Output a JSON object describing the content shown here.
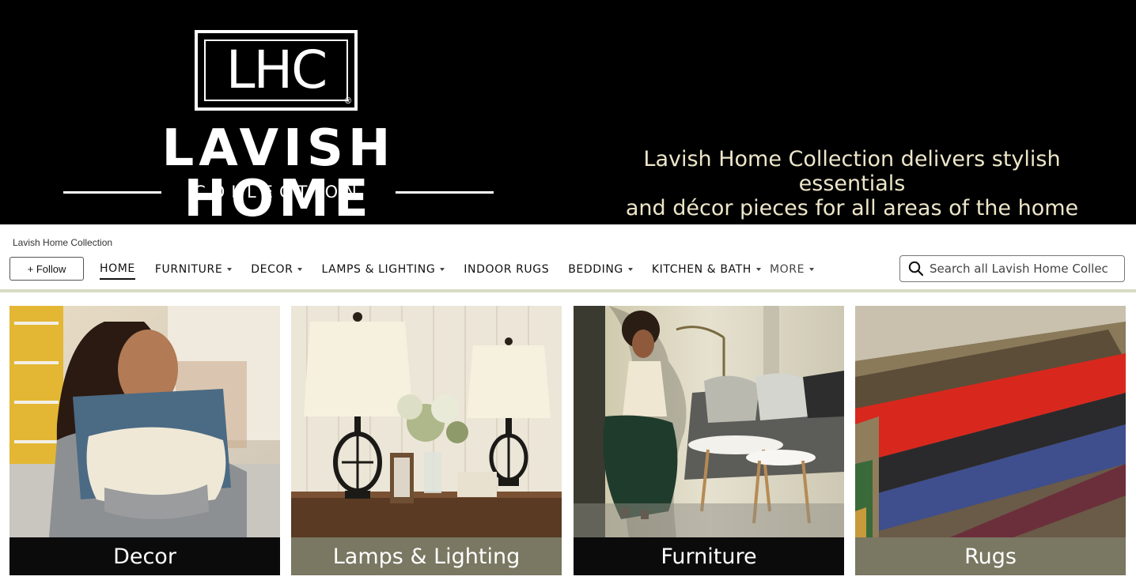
{
  "hero": {
    "logo_letters": "LHC",
    "logo_reg": "®",
    "brand_name": "LAVISH HOME",
    "brand_sub": "COLLECTION",
    "tagline_line1": "Lavish Home Collection delivers stylish essentials",
    "tagline_line2": "and décor pieces for all areas of the home"
  },
  "store": {
    "name": "Lavish Home Collection",
    "follow_label": "+ Follow"
  },
  "nav": {
    "items": [
      {
        "label": "HOME",
        "active": true,
        "dropdown": false
      },
      {
        "label": "FURNITURE",
        "active": false,
        "dropdown": true
      },
      {
        "label": "DECOR",
        "active": false,
        "dropdown": true
      },
      {
        "label": "LAMPS & LIGHTING",
        "active": false,
        "dropdown": true
      },
      {
        "label": "INDOOR RUGS",
        "active": false,
        "dropdown": false
      },
      {
        "label": "BEDDING",
        "active": false,
        "dropdown": true
      },
      {
        "label": "KITCHEN & BATH",
        "active": false,
        "dropdown": true
      },
      {
        "label": "MORE",
        "active": false,
        "dropdown": true
      }
    ]
  },
  "search": {
    "placeholder": "Search all Lavish Home Collec",
    "icon": "search-icon"
  },
  "tiles": [
    {
      "caption": "Decor",
      "caption_bg": "#0b0b0b"
    },
    {
      "caption": "Lamps & Lighting",
      "caption_bg": "#7a7762"
    },
    {
      "caption": "Furniture",
      "caption_bg": "#0b0b0b"
    },
    {
      "caption": "Rugs",
      "caption_bg": "#7a7762"
    }
  ],
  "colors": {
    "banner_bg": "#000000",
    "tagline": "#ede6c9",
    "divider": "#d9dcc4"
  }
}
